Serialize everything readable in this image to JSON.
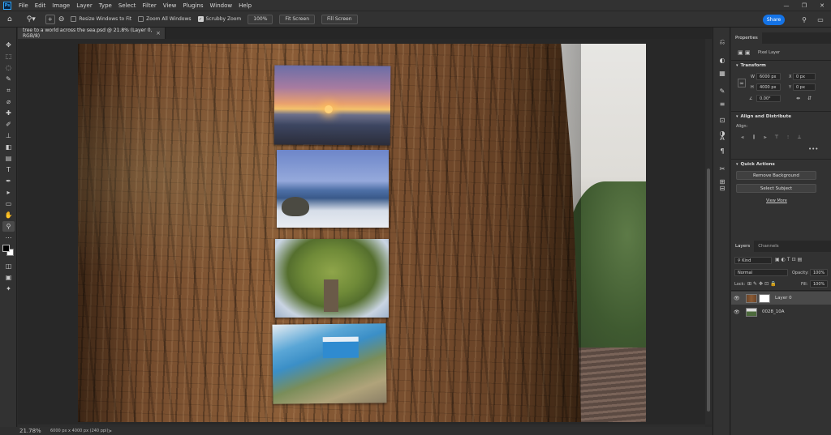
{
  "app": {
    "logo": "Ps"
  },
  "menu": [
    "File",
    "Edit",
    "Image",
    "Layer",
    "Type",
    "Select",
    "Filter",
    "View",
    "Plugins",
    "Window",
    "Help"
  ],
  "window_controls": {
    "minimize": "—",
    "maximize": "❐",
    "close": "✕"
  },
  "options_bar": {
    "resize_windows_label": "Resize Windows to Fit",
    "resize_windows_checked": false,
    "zoom_all_label": "Zoom All Windows",
    "zoom_all_checked": false,
    "scrubby_zoom_label": "Scrubby Zoom",
    "scrubby_zoom_checked": true,
    "zoom_100_label": "100%",
    "fit_screen_label": "Fit Screen",
    "fill_screen_label": "Fill Screen",
    "share_label": "Share"
  },
  "document_tab": {
    "title": "tree to a world across the sea.psd @ 21.8% (Layer 0, RGB/8)",
    "close": "×"
  },
  "status_bar": {
    "zoom": "21.78%",
    "info": "6000 px x 4000 px (240 ppi)",
    "arrow": ">"
  },
  "properties": {
    "tabs": [
      "Properties"
    ],
    "layer_type": "Pixel Layer",
    "transform": {
      "title": "Transform",
      "w_label": "W",
      "w_value": "6000 px",
      "h_label": "H",
      "h_value": "4000 px",
      "x_label": "X",
      "x_value": "0 px",
      "y_label": "Y",
      "y_value": "0 px",
      "angle": "0.00°"
    },
    "align": {
      "title": "Align and Distribute",
      "align_label": "Align:"
    },
    "quick_actions": {
      "title": "Quick Actions",
      "remove_bg": "Remove Background",
      "select_subject": "Select Subject",
      "view_more": "View More"
    }
  },
  "layers_panel": {
    "tabs": [
      "Layers",
      "Channels"
    ],
    "filter_kind": "Kind",
    "blend_mode": "Normal",
    "opacity_label": "Opacity:",
    "opacity_value": "100%",
    "lock_label": "Lock:",
    "fill_label": "Fill:",
    "fill_value": "100%",
    "layers": [
      {
        "name": "Layer 0",
        "selected": true
      },
      {
        "name": "0028_10A",
        "selected": false
      }
    ]
  },
  "colors": {
    "accent": "#1473e6",
    "panel": "#323232",
    "canvas_bg": "#282828"
  }
}
